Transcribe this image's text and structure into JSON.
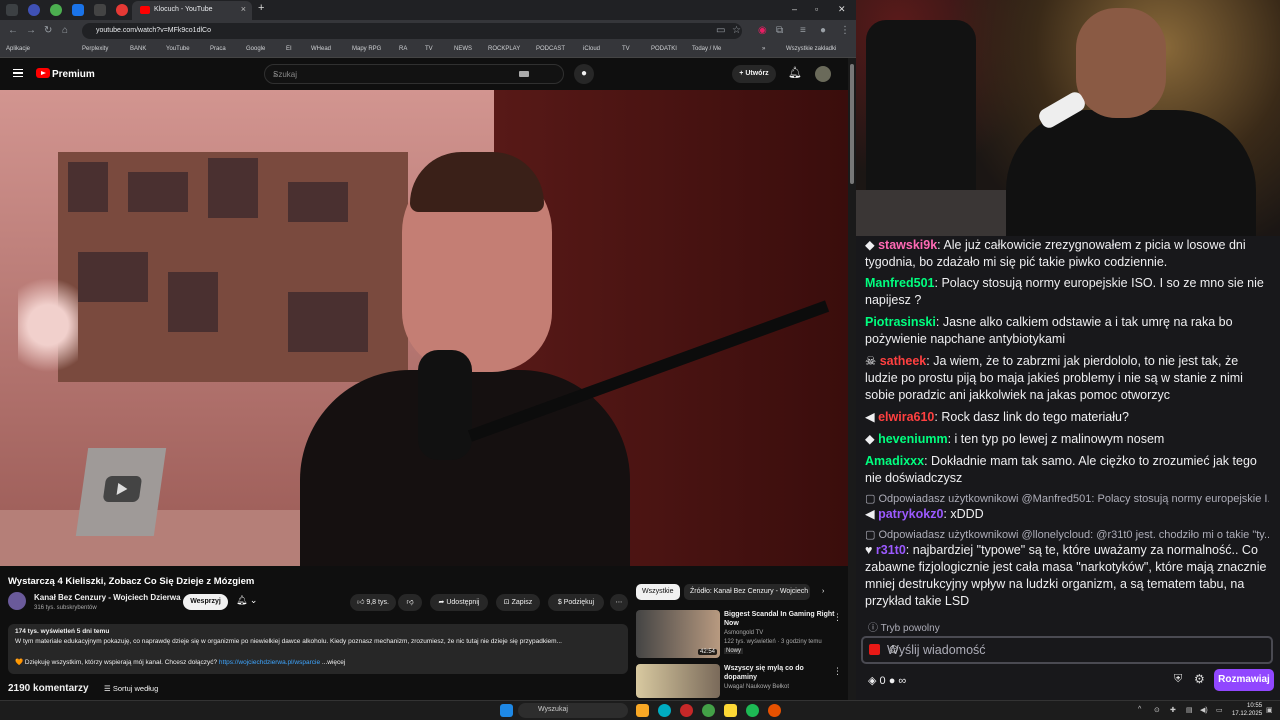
{
  "browser": {
    "tab_title": "Klocuch - YouTube",
    "url": "youtube.com/watch?v=MFk9co1dlCo",
    "bookmarks": [
      "Aplikacje",
      "Perplexity",
      "BANK",
      "YouTube",
      "Praca",
      "Google",
      "EI",
      "WHead",
      "Mapy RPG",
      "RA",
      "TV",
      "NEWS",
      "ROCKPLAY",
      "PODCAST",
      "iCloud",
      "TV",
      "PODATKI",
      "Today / Me"
    ],
    "all_bookmarks": "Wszystkie zakładki"
  },
  "youtube": {
    "logo": "Premium",
    "search_placeholder": "Szukaj",
    "create": "Utwórz",
    "video_title": "Wystarczą 4 Kieliszki, Zobacz Co Się Dzieje z Mózgiem",
    "channel_name": "Kanał Bez Cenzury - Wojciech Dzierwa",
    "subscribers": "316 tys. subskrybentów",
    "support_btn": "Wesprzyj",
    "likes": "9,8 tys.",
    "share": "Udostępnij",
    "save": "Zapisz",
    "thanks": "Podziękuj",
    "desc_meta": "174 tys. wyświetleń  5 dni temu",
    "desc_line": "W tym materiale edukacyjnym pokazuję, co naprawdę dzieje się w organizmie po niewielkiej dawce alkoholu. Kiedy poznasz mechanizm, zrozumiesz, że nic tutaj nie dzieje się przypadkiem...",
    "desc_thanks": "Dziękuję wszystkim, którzy wspierają mój kanał. Chcesz dołączyć?",
    "desc_link": "https://wojciechdzierwa.pl/wsparcie",
    "desc_more": "...więcej",
    "comments_count": "2190 komentarzy",
    "sort_by": "Sortuj według",
    "chips": [
      "Wszystkie",
      "Źródło: Kanał Bez Cenzury - Wojciech"
    ],
    "recommended": [
      {
        "title": "Biggest Scandal In Gaming Right Now",
        "channel": "Asmongold TV",
        "meta": "122 tys. wyświetleń · 3 godziny temu",
        "badge": "Nowy",
        "duration": "42:54"
      },
      {
        "title": "Wszyscy się mylą co do dopaminy",
        "channel": "Uwaga! Naukowy Bełkot",
        "meta": "",
        "badge": "",
        "duration": ""
      }
    ]
  },
  "chat": {
    "messages": [
      {
        "user": "stawski9k",
        "color": "#ff69b4",
        "text": "Ale już całkowicie zrezygnowałem z picia w losowe dni tygodnia, bo zdażało mi się pić takie piwko codziennie."
      },
      {
        "user": "Manfred501",
        "color": "#00ff7f",
        "text": "Polacy stosują normy europejskie ISO. I so ze mno sie nie napijesz ?"
      },
      {
        "user": "Piotrasinski",
        "color": "#00ff7f",
        "text": "Jasne alko calkiem odstawie a i tak umrę na raka bo pożywienie napchane antybiotykami"
      },
      {
        "user": "satheek",
        "color": "#ff4040",
        "text": "Ja wiem, że to zabrzmi jak pierdololo, to nie jest tak, że ludzie po prostu piją bo maja jakieś problemy i nie są w stanie z nimi sobie poradzic ani jakkolwiek na jakas pomoc otworzyc"
      },
      {
        "user": "elwira610",
        "color": "#ff4040",
        "text": "Rock dasz link do tego materiału?"
      },
      {
        "user": "heveniumm",
        "color": "#00ff7f",
        "text": "i ten typ po lewej z malinowym nosem"
      },
      {
        "user": "Amadixxx",
        "color": "#00ff7f",
        "text": "Dokładnie mam tak samo. Ale ciężko to zrozumieć jak tego nie doświadczysz"
      },
      {
        "user": "patrykokz0",
        "color": "#9b59ff",
        "text": "xDDD",
        "reply": "Odpowiadasz użytkownikowi @Manfred501: Polacy stosują normy europejskie I..."
      },
      {
        "user": "r31t0",
        "color": "#9b59ff",
        "text": "najbardziej \"typowe\" są te, które uważamy za normalność.. Co zabawne fizjologicznie jest cała masa \"narkotyków\", które mają znacznie mniej destrukcyjny wpływ na ludzki organizm, a są tematem tabu, na przykład takie LSD",
        "reply": "Odpowiadasz użytkownikowi @llonelycloud: @r31t0 jest. chodziło mi o takie \"ty..."
      }
    ],
    "slow_mode": "Tryb powolny",
    "input_placeholder": "Wyślij wiadomość",
    "points": "0",
    "chat_button": "Rozmawiaj"
  },
  "taskbar": {
    "search": "Wyszukaj",
    "time": "10:55",
    "date": "17.12.2025"
  }
}
